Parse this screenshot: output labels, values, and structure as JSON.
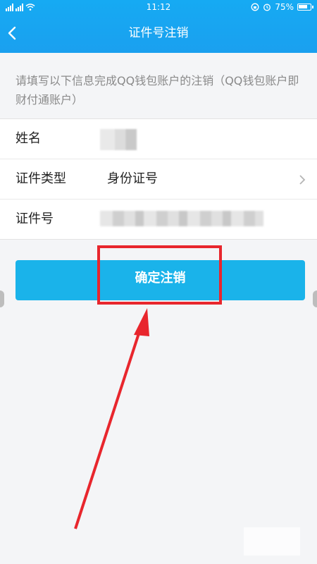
{
  "status_bar": {
    "carrier": "ⓔ",
    "time": "11:12",
    "battery": "75%"
  },
  "nav": {
    "title": "证件号注销"
  },
  "intro_text": "请填写以下信息完成QQ钱包账户的注销（QQ钱包账户即财付通账户）",
  "form": {
    "rows": [
      {
        "label": "姓名",
        "value": ""
      },
      {
        "label": "证件类型",
        "value": "身份证号"
      },
      {
        "label": "证件号",
        "value": ""
      }
    ]
  },
  "confirm_button": {
    "label": "确定注销"
  },
  "colors": {
    "header": "#16aaf3",
    "button": "#1ab3ea",
    "annotation": "#e8262d"
  },
  "icons": [
    "back-arrow-icon",
    "signal-icon",
    "wifi-icon",
    "alarm-icon",
    "lock-rotation-icon",
    "battery-icon",
    "chevron-right-icon"
  ]
}
